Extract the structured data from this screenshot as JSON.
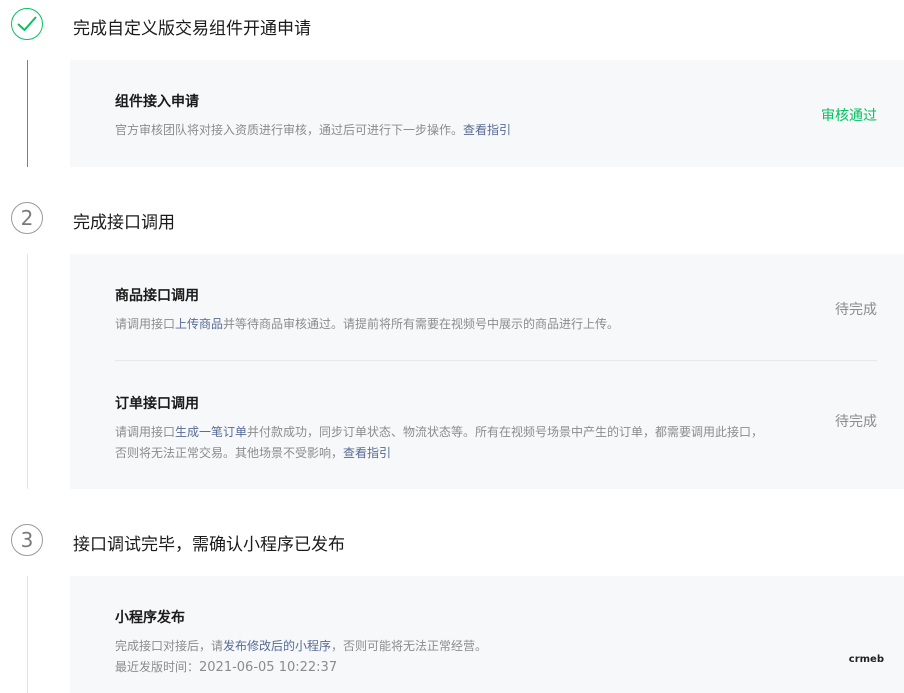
{
  "steps": [
    {
      "number": "",
      "title": "完成自定义版交易组件开通申请",
      "state": "done",
      "items": [
        {
          "title": "组件接入申请",
          "desc_parts": [
            "官方审核团队将对接入资质进行审核，通过后可进行下一步操作。"
          ],
          "link": "查看指引",
          "status": "审核通过"
        }
      ]
    },
    {
      "number": "2",
      "title": "完成接口调用",
      "state": "pending",
      "items": [
        {
          "title": "商品接口调用",
          "desc_prefix": "请调用接口",
          "desc_highlight": "上传商品",
          "desc_suffix": "并等待商品审核通过。请提前将所有需要在视频号中展示的商品进行上传。",
          "status": "待完成"
        },
        {
          "title": "订单接口调用",
          "desc_prefix": "请调用接口",
          "desc_highlight": "生成一笔订单",
          "desc_suffix_line1": "并付款成功，同步订单状态、物流状态等。所有在视频号场景中产生的订单，都需要调用此接口，",
          "desc_line2": "否则将无法正常交易。其他场景不受影响，",
          "link": "查看指引",
          "status": "待完成"
        }
      ]
    },
    {
      "number": "3",
      "title": "接口调试完毕，需确认小程序已发布",
      "state": "pending",
      "items": [
        {
          "title": "小程序发布",
          "desc_prefix": "完成接口对接后，请",
          "desc_highlight": "发布修改后的小程序",
          "desc_suffix": "，否则可能将无法正常经营。",
          "release_label": "最近发版时间：",
          "release_time": "2021-06-05 10:22:37"
        }
      ]
    }
  ],
  "watermark": "crmeb",
  "colors": {
    "green": "#07c160",
    "link": "#576b95",
    "muted": "#8c8c8c"
  }
}
